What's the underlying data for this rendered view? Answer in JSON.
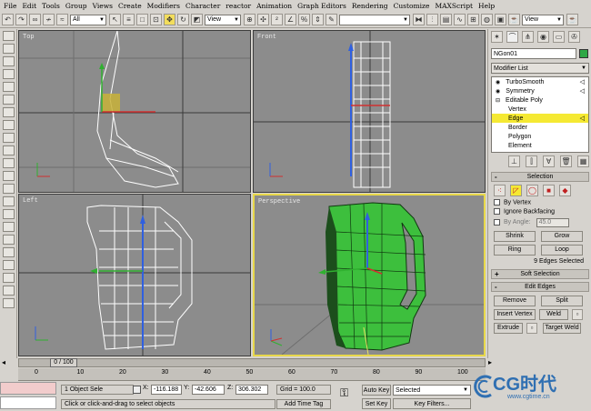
{
  "menu": [
    "File",
    "Edit",
    "Tools",
    "Group",
    "Views",
    "Create",
    "Modifiers",
    "Character",
    "reactor",
    "Animation",
    "Graph Editors",
    "Rendering",
    "Customize",
    "MAXScript",
    "Help"
  ],
  "toolbar": {
    "filter_value": "All",
    "coord_value": "View",
    "coord_value2": "View"
  },
  "viewports": {
    "top": "Top",
    "front": "Front",
    "left": "Left",
    "perspective": "Perspective"
  },
  "panel": {
    "object_name": "NGon01",
    "object_color": "#2ea845",
    "modifier_list": "Modifier List",
    "stack": [
      "TurboSmooth",
      "Symmetry",
      "Editable Poly",
      "Vertex",
      "Edge",
      "Border",
      "Polygon",
      "Element"
    ],
    "selected_stack_item": "Edge",
    "selection_title": "Selection",
    "by_vertex": "By Vertex",
    "ignore_backfacing": "Ignore Backfacing",
    "by_angle": "By Angle:",
    "by_angle_value": "45.0",
    "shrink": "Shrink",
    "grow": "Grow",
    "ring": "Ring",
    "loop": "Loop",
    "selection_status": "9 Edges Selected",
    "soft_selection": "Soft Selection",
    "edit_edges": "Edit Edges",
    "remove": "Remove",
    "split": "Split",
    "insert_vertex": "Insert Vertex",
    "weld": "Weld",
    "extrude": "Extrude",
    "target_weld": "Target Weld"
  },
  "timeline": {
    "frame": "0 / 100",
    "ticks": [
      "0",
      "10",
      "20",
      "30",
      "40",
      "50",
      "60",
      "70",
      "80",
      "90",
      "100"
    ]
  },
  "status": {
    "selection": "1 Object Sele",
    "x_label": "X:",
    "x": "-116.188",
    "y_label": "Y:",
    "y": "-42.606",
    "z_label": "Z:",
    "z": "306.302",
    "grid": "Grid = 100.0",
    "prompt": "Click or click-and-drag to select objects",
    "add_time_tag": "Add Time Tag",
    "auto_key": "Auto Key",
    "set_key": "Set Key",
    "selected": "Selected",
    "key_filters": "Key Filters..."
  },
  "watermark": {
    "logo": "CG时代",
    "url": "www.cgtime.cn"
  },
  "colors": {
    "selection_yellow": "#f5e933",
    "model_green": "#3dbf3d",
    "viewport_bg": "#8c8c8c"
  }
}
